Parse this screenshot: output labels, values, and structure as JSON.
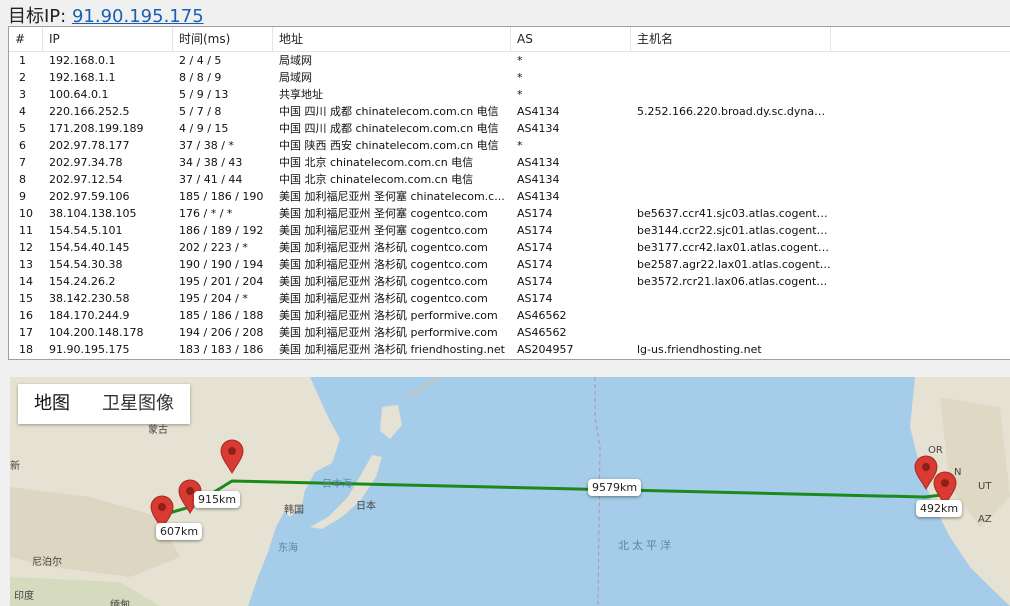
{
  "header": {
    "label": "目标IP:",
    "ip": "91.90.195.175"
  },
  "table": {
    "columns": [
      "#",
      "IP",
      "时间(ms)",
      "地址",
      "AS",
      "主机名"
    ],
    "rows": [
      [
        "1",
        "192.168.0.1",
        "2 / 4 / 5",
        "局域网",
        "*",
        ""
      ],
      [
        "2",
        "192.168.1.1",
        "8 / 8 / 9",
        "局域网",
        "*",
        ""
      ],
      [
        "3",
        "100.64.0.1",
        "5 / 9 / 13",
        "共享地址",
        "*",
        ""
      ],
      [
        "4",
        "220.166.252.5",
        "5 / 7 / 8",
        "中国 四川 成都 chinatelecom.com.cn 电信",
        "AS4134",
        "5.252.166.220.broad.dy.sc.dynami..."
      ],
      [
        "5",
        "171.208.199.189",
        "4 / 9 / 15",
        "中国 四川 成都 chinatelecom.com.cn 电信",
        "AS4134",
        ""
      ],
      [
        "6",
        "202.97.78.177",
        "37 / 38 / *",
        "中国 陕西 西安 chinatelecom.com.cn 电信",
        "*",
        ""
      ],
      [
        "7",
        "202.97.34.78",
        "34 / 38 / 43",
        "中国 北京 chinatelecom.com.cn 电信",
        "AS4134",
        ""
      ],
      [
        "8",
        "202.97.12.54",
        "37 / 41 / 44",
        "中国 北京 chinatelecom.com.cn 电信",
        "AS4134",
        ""
      ],
      [
        "9",
        "202.97.59.106",
        "185 / 186 / 190",
        "美国 加利福尼亚州 圣何塞 chinatelecom.c...",
        "AS4134",
        ""
      ],
      [
        "10",
        "38.104.138.105",
        "176 / * / *",
        "美国 加利福尼亚州 圣何塞 cogentco.com",
        "AS174",
        "be5637.ccr41.sjc03.atlas.cogentco...."
      ],
      [
        "11",
        "154.54.5.101",
        "186 / 189 / 192",
        "美国 加利福尼亚州 圣何塞 cogentco.com",
        "AS174",
        "be3144.ccr22.sjc01.atlas.cogentco...."
      ],
      [
        "12",
        "154.54.40.145",
        "202 / 223 / *",
        "美国 加利福尼亚州 洛杉矶 cogentco.com",
        "AS174",
        "be3177.ccr42.lax01.atlas.cogentco...."
      ],
      [
        "13",
        "154.54.30.38",
        "190 / 190 / 194",
        "美国 加利福尼亚州 洛杉矶 cogentco.com",
        "AS174",
        "be2587.agr22.lax01.atlas.cogentco...."
      ],
      [
        "14",
        "154.24.26.2",
        "195 / 201 / 204",
        "美国 加利福尼亚州 洛杉矶 cogentco.com",
        "AS174",
        "be3572.rcr21.lax06.atlas.cogentco...."
      ],
      [
        "15",
        "38.142.230.58",
        "195 / 204 / *",
        "美国 加利福尼亚州 洛杉矶 cogentco.com",
        "AS174",
        ""
      ],
      [
        "16",
        "184.170.244.9",
        "185 / 186 / 188",
        "美国 加利福尼亚州 洛杉矶 performive.com",
        "AS46562",
        ""
      ],
      [
        "17",
        "104.200.148.178",
        "194 / 206 / 208",
        "美国 加利福尼亚州 洛杉矶 performive.com",
        "AS46562",
        ""
      ],
      [
        "18",
        "91.90.195.175",
        "183 / 183 / 186",
        "美国 加利福尼亚州 洛杉矶 friendhosting.net",
        "AS204957",
        "lg-us.friendhosting.net"
      ]
    ]
  },
  "map": {
    "tabs": [
      "地图",
      "卫星图像"
    ],
    "distances": [
      "915km",
      "607km",
      "9579km",
      "492km"
    ],
    "places": [
      "蒙古",
      "新",
      "韩国",
      "日本",
      "日本海",
      "东海",
      "北太平洋",
      "尼泊尔",
      "印度",
      "缅甸",
      "OR",
      "UT",
      "AZ",
      "N"
    ],
    "colors": {
      "ocean": "#a5cde9",
      "land": "#e9e5d8",
      "route": "#1a8a1a",
      "marker": "#d93a32"
    }
  }
}
